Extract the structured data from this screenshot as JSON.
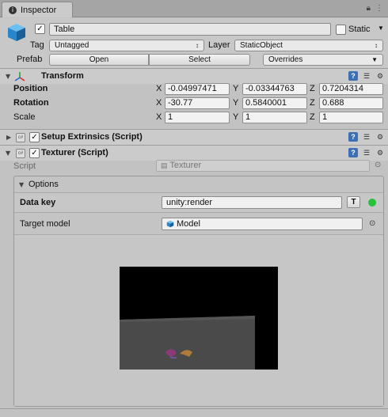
{
  "window": {
    "tab_title": "Inspector",
    "lock_icon": "lock-icon",
    "menu_icon": "menu-icon"
  },
  "object": {
    "name": "Table",
    "active": true,
    "static_label": "Static",
    "static_checked": false,
    "tag_label": "Tag",
    "tag_value": "Untagged",
    "layer_label": "Layer",
    "layer_value": "StaticObject",
    "prefab_label": "Prefab",
    "prefab_open": "Open",
    "prefab_select": "Select",
    "prefab_overrides": "Overrides"
  },
  "transform": {
    "title": "Transform",
    "rows": [
      {
        "label": "Position",
        "x": "-0.04997471",
        "y": "-0.03344763",
        "z": "0.7204314"
      },
      {
        "label": "Rotation",
        "x": "-30.77",
        "y": "0.5840001",
        "z": "0.688"
      },
      {
        "label": "Scale",
        "x": "1",
        "y": "1",
        "z": "1"
      }
    ],
    "axis_x": "X",
    "axis_y": "Y",
    "axis_z": "Z"
  },
  "setup_extrinsics": {
    "title": "Setup Extrinsics (Script)",
    "enabled": true
  },
  "texturer": {
    "title": "Texturer (Script)",
    "enabled": true,
    "script_label": "Script",
    "script_value": "Texturer",
    "options_label": "Options",
    "data_key_label": "Data key",
    "data_key_value": "unity:render",
    "data_key_button": "T",
    "status_color": "#27c13a",
    "target_model_label": "Target model",
    "target_model_value": "Model"
  },
  "colors": {
    "panel": "#c2c2c2",
    "help_icon": "#3d6fb4"
  }
}
